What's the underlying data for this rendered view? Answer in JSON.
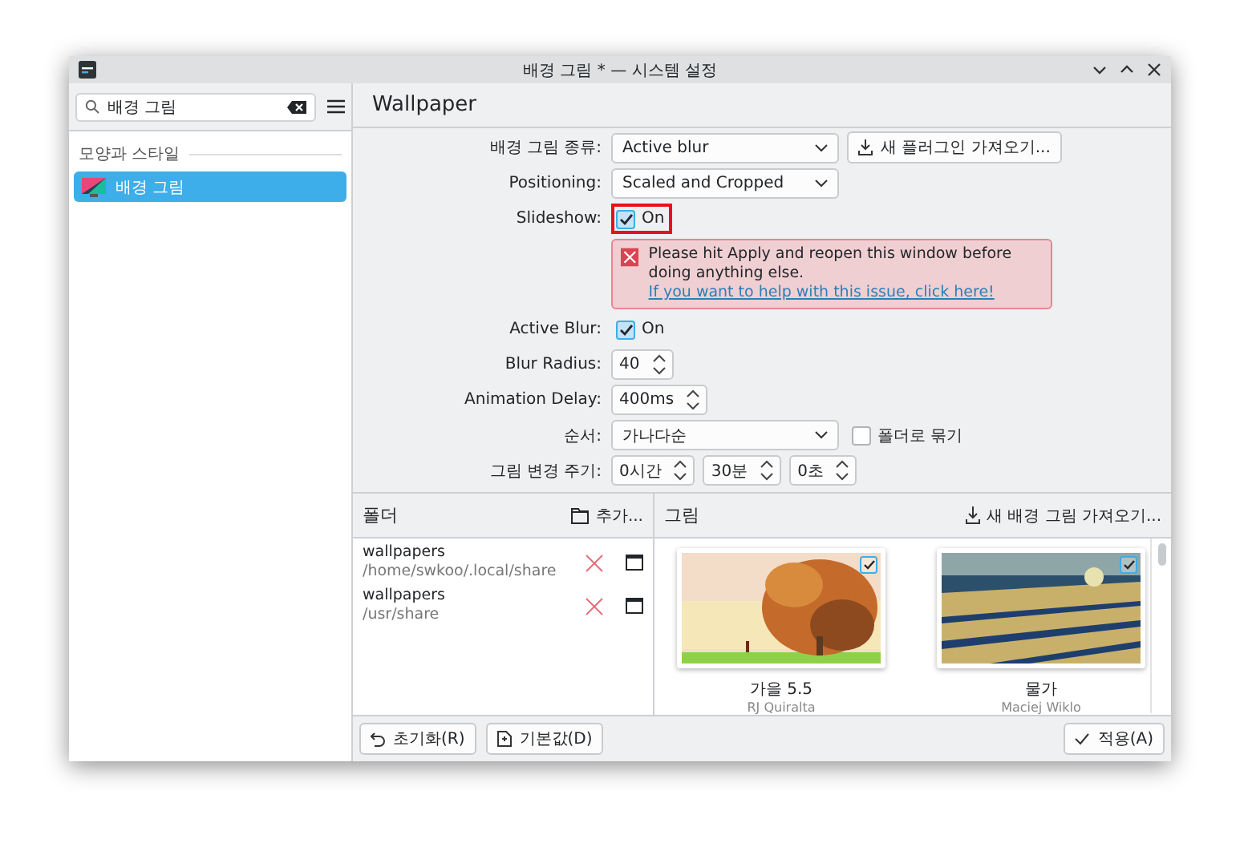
{
  "window": {
    "title": "배경 그림 * — 시스템 설정"
  },
  "search": {
    "value": "배경 그림"
  },
  "sidebar": {
    "section": "모양과 스타일",
    "items": [
      {
        "label": "배경 그림",
        "selected": true
      }
    ]
  },
  "header": {
    "title": "Wallpaper"
  },
  "form": [
    {
      "kind": "field",
      "label": "배경 그림 종류:",
      "controls": [
        {
          "kind": "select",
          "value": "Active blur"
        },
        {
          "kind": "button",
          "label": "새 플러그인 가져오기..."
        }
      ]
    },
    {
      "kind": "field",
      "label": "Positioning:",
      "controls": [
        {
          "kind": "select",
          "value": "Scaled and Cropped"
        }
      ]
    },
    {
      "kind": "field",
      "label": "Slideshow:",
      "highlighted": true,
      "controls": [
        {
          "kind": "checkbox",
          "label": "On",
          "checked": true
        }
      ]
    },
    {
      "kind": "notice",
      "message": "Please hit Apply and reopen this window before doing anything else.",
      "link": "If you want to help with this issue, click here!"
    },
    {
      "kind": "field",
      "label": "Active Blur:",
      "controls": [
        {
          "kind": "checkbox",
          "label": "On",
          "checked": true
        }
      ]
    },
    {
      "kind": "field",
      "label": "Blur Radius:",
      "controls": [
        {
          "kind": "spin",
          "value": "40"
        }
      ]
    },
    {
      "kind": "field",
      "label": "Animation Delay:",
      "controls": [
        {
          "kind": "spin",
          "value": "400ms"
        }
      ]
    },
    {
      "kind": "field",
      "label": "순서:",
      "controls": [
        {
          "kind": "select",
          "value": "가나다순"
        },
        {
          "kind": "checkbox",
          "label": "폴더로 묶기",
          "checked": false
        }
      ]
    },
    {
      "kind": "field",
      "label": "그림 변경 주기:",
      "controls": [
        {
          "kind": "spin",
          "value": "0시간"
        },
        {
          "kind": "spin",
          "value": "30분"
        },
        {
          "kind": "spin",
          "value": "0초"
        }
      ]
    }
  ],
  "folders": {
    "title": "폴더",
    "add": "추가...",
    "items": [
      {
        "name": "wallpapers",
        "path": "/home/swkoo/.local/share"
      },
      {
        "name": "wallpapers",
        "path": "/usr/share"
      }
    ]
  },
  "pictures": {
    "title": "그림",
    "download": "새 배경 그림 가져오기...",
    "items": [
      {
        "kind": "picture",
        "name": "가을 5.5",
        "author": "RJ Quiralta",
        "checked": true
      },
      {
        "kind": "picture",
        "name": "물가",
        "author": "Maciej Wiklo",
        "checked": true
      }
    ]
  },
  "footer": {
    "left": [
      {
        "kind": "reset",
        "label": "초기화(R)"
      },
      {
        "kind": "defaults",
        "label": "기본값(D)"
      }
    ],
    "right": [
      {
        "kind": "apply",
        "label": "적용(A)"
      }
    ]
  }
}
